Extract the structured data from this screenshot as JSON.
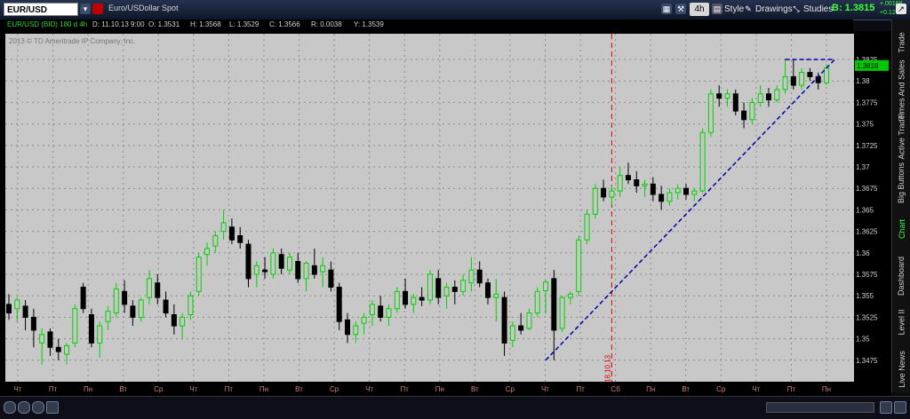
{
  "toolbar": {
    "symbol": "EUR/USD",
    "description": "Euro/USDollar Spot",
    "aggregation": "4h",
    "style_label": "Style",
    "drawings_label": "Drawings",
    "studies_label": "Studies",
    "bid_label": "B: 1.3815",
    "change_abs": "+.00168",
    "change_pct": "+0.12%"
  },
  "info": {
    "title": "EUR/USD (BID) 180 d 4h",
    "date": "D: 11.10.13 9:00",
    "open": "O: 1.3531",
    "high": "H: 1.3568",
    "low": "L: 1.3529",
    "close": "C: 1.3566",
    "range": "R: 0.0038",
    "y": "Y: 1.3539",
    "copyright": "2013 © TD Ameritrade IP Company, Inc."
  },
  "sidebar": {
    "tabs": [
      "Trade",
      "Times And Sales",
      "Active Trader",
      "Big Buttons",
      "Chart",
      "Dashboard",
      "Level II",
      "Live News"
    ],
    "active": "Chart"
  },
  "colors": {
    "bull": "#00d200",
    "bear": "#000000",
    "plot_bg": "#c8c8c8",
    "trendline": "#0000a8",
    "marker": "#e00000"
  },
  "chart_data": {
    "type": "candlestick",
    "ylim": [
      1.345,
      1.3855
    ],
    "y_ticks": [
      "1.3475",
      "1.35",
      "1.3525",
      "1.355",
      "1.3575",
      "1.36",
      "1.3625",
      "1.365",
      "1.3675",
      "1.37",
      "1.3725",
      "1.375",
      "1.3775",
      "1.38",
      "1.3825"
    ],
    "x_labels": [
      "Чт",
      "Пт",
      "Пн",
      "Вт",
      "Ср",
      "Чт",
      "Пт",
      "Пн",
      "Вт",
      "Ср",
      "Чт",
      "Пт",
      "Пн",
      "Вт",
      "Ср",
      "Чт",
      "Пт",
      "Сб",
      "Пн",
      "Вт",
      "Ср",
      "Чт",
      "Пт",
      "Пн"
    ],
    "last_price": "1.3818",
    "marker_label": "18.10.13",
    "grid": true,
    "candles": [
      [
        1.354,
        1.3552,
        1.3522,
        1.353
      ],
      [
        1.3535,
        1.3548,
        1.352,
        1.3545
      ],
      [
        1.3538,
        1.3545,
        1.351,
        1.3525
      ],
      [
        1.3525,
        1.3535,
        1.349,
        1.351
      ],
      [
        1.3495,
        1.3512,
        1.347,
        1.3505
      ],
      [
        1.3508,
        1.3512,
        1.348,
        1.349
      ],
      [
        1.349,
        1.35,
        1.3475,
        1.3485
      ],
      [
        1.3482,
        1.3495,
        1.347,
        1.3492
      ],
      [
        1.3495,
        1.354,
        1.349,
        1.3535
      ],
      [
        1.356,
        1.3565,
        1.353,
        1.3535
      ],
      [
        1.3528,
        1.3535,
        1.349,
        1.3495
      ],
      [
        1.3495,
        1.352,
        1.3478,
        1.3515
      ],
      [
        1.352,
        1.3538,
        1.351,
        1.3532
      ],
      [
        1.353,
        1.3565,
        1.3525,
        1.3558
      ],
      [
        1.3555,
        1.3568,
        1.353,
        1.354
      ],
      [
        1.3538,
        1.3545,
        1.3515,
        1.3525
      ],
      [
        1.3525,
        1.3548,
        1.352,
        1.3545
      ],
      [
        1.3548,
        1.358,
        1.354,
        1.357
      ],
      [
        1.3565,
        1.3575,
        1.354,
        1.3548
      ],
      [
        1.3545,
        1.3555,
        1.3525,
        1.353
      ],
      [
        1.3528,
        1.354,
        1.3505,
        1.3515
      ],
      [
        1.3515,
        1.353,
        1.35,
        1.3525
      ],
      [
        1.3528,
        1.3555,
        1.3522,
        1.355
      ],
      [
        1.3555,
        1.36,
        1.355,
        1.3595
      ],
      [
        1.3598,
        1.3612,
        1.3585,
        1.3605
      ],
      [
        1.3608,
        1.3625,
        1.36,
        1.362
      ],
      [
        1.3625,
        1.365,
        1.3615,
        1.3635
      ],
      [
        1.363,
        1.364,
        1.361,
        1.3615
      ],
      [
        1.362,
        1.363,
        1.3605,
        1.3612
      ],
      [
        1.361,
        1.3615,
        1.356,
        1.357
      ],
      [
        1.3575,
        1.359,
        1.356,
        1.3585
      ],
      [
        1.358,
        1.3595,
        1.357,
        1.3578
      ],
      [
        1.3575,
        1.3605,
        1.357,
        1.36
      ],
      [
        1.3598,
        1.3605,
        1.3575,
        1.3582
      ],
      [
        1.358,
        1.36,
        1.3575,
        1.3595
      ],
      [
        1.359,
        1.36,
        1.3565,
        1.357
      ],
      [
        1.357,
        1.359,
        1.3555,
        1.3588
      ],
      [
        1.3585,
        1.3605,
        1.357,
        1.3575
      ],
      [
        1.3578,
        1.3595,
        1.356,
        1.3585
      ],
      [
        1.358,
        1.359,
        1.3555,
        1.356
      ],
      [
        1.356,
        1.3565,
        1.351,
        1.352
      ],
      [
        1.3522,
        1.353,
        1.3495,
        1.3505
      ],
      [
        1.3505,
        1.352,
        1.3495,
        1.3515
      ],
      [
        1.3518,
        1.353,
        1.3505,
        1.3525
      ],
      [
        1.3528,
        1.3545,
        1.3515,
        1.354
      ],
      [
        1.3538,
        1.355,
        1.352,
        1.3525
      ],
      [
        1.3525,
        1.354,
        1.3515,
        1.3535
      ],
      [
        1.3535,
        1.356,
        1.353,
        1.3555
      ],
      [
        1.3555,
        1.357,
        1.3535,
        1.354
      ],
      [
        1.354,
        1.3552,
        1.353,
        1.3548
      ],
      [
        1.3548,
        1.356,
        1.3538,
        1.3545
      ],
      [
        1.3545,
        1.358,
        1.354,
        1.3575
      ],
      [
        1.357,
        1.358,
        1.354,
        1.3548
      ],
      [
        1.355,
        1.3565,
        1.3535,
        1.356
      ],
      [
        1.356,
        1.3568,
        1.354,
        1.3555
      ],
      [
        1.3555,
        1.3575,
        1.355,
        1.3568
      ],
      [
        1.3565,
        1.3595,
        1.3555,
        1.358
      ],
      [
        1.358,
        1.359,
        1.356,
        1.3565
      ],
      [
        1.3565,
        1.357,
        1.354,
        1.3548
      ],
      [
        1.3548,
        1.357,
        1.352,
        1.3552
      ],
      [
        1.3548,
        1.3555,
        1.348,
        1.3495
      ],
      [
        1.3498,
        1.352,
        1.349,
        1.3515
      ],
      [
        1.3515,
        1.353,
        1.3505,
        1.351
      ],
      [
        1.3512,
        1.3535,
        1.351,
        1.353
      ],
      [
        1.353,
        1.356,
        1.3525,
        1.3555
      ],
      [
        1.3556,
        1.3568,
        1.3529,
        1.3566
      ],
      [
        1.357,
        1.358,
        1.3475,
        1.351
      ],
      [
        1.3512,
        1.355,
        1.3508,
        1.3548
      ],
      [
        1.3548,
        1.3555,
        1.354,
        1.3552
      ],
      [
        1.3555,
        1.362,
        1.355,
        1.3615
      ],
      [
        1.3615,
        1.365,
        1.361,
        1.3645
      ],
      [
        1.3645,
        1.368,
        1.364,
        1.3675
      ],
      [
        1.3675,
        1.3685,
        1.366,
        1.3665
      ],
      [
        1.3665,
        1.3678,
        1.3655,
        1.3672
      ],
      [
        1.3672,
        1.37,
        1.3665,
        1.369
      ],
      [
        1.369,
        1.3705,
        1.368,
        1.3685
      ],
      [
        1.3685,
        1.3695,
        1.367,
        1.3678
      ],
      [
        1.3678,
        1.3685,
        1.3665,
        1.368
      ],
      [
        1.368,
        1.3688,
        1.366,
        1.3668
      ],
      [
        1.3668,
        1.3678,
        1.365,
        1.366
      ],
      [
        1.366,
        1.3675,
        1.3655,
        1.367
      ],
      [
        1.367,
        1.368,
        1.3662,
        1.3675
      ],
      [
        1.3675,
        1.368,
        1.3662,
        1.3668
      ],
      [
        1.3668,
        1.3675,
        1.366,
        1.3672
      ],
      [
        1.3672,
        1.3745,
        1.367,
        1.374
      ],
      [
        1.374,
        1.379,
        1.3735,
        1.3785
      ],
      [
        1.3785,
        1.3795,
        1.377,
        1.378
      ],
      [
        1.378,
        1.379,
        1.377,
        1.3785
      ],
      [
        1.3785,
        1.379,
        1.376,
        1.3765
      ],
      [
        1.3765,
        1.3775,
        1.3745,
        1.3755
      ],
      [
        1.3755,
        1.378,
        1.375,
        1.3775
      ],
      [
        1.3775,
        1.3795,
        1.377,
        1.3785
      ],
      [
        1.3785,
        1.3792,
        1.377,
        1.3778
      ],
      [
        1.3778,
        1.3795,
        1.3775,
        1.379
      ],
      [
        1.379,
        1.3825,
        1.3785,
        1.3805
      ],
      [
        1.3805,
        1.3825,
        1.379,
        1.3795
      ],
      [
        1.3795,
        1.3815,
        1.379,
        1.381
      ],
      [
        1.381,
        1.3815,
        1.38,
        1.3805
      ],
      [
        1.3805,
        1.381,
        1.379,
        1.3798
      ],
      [
        1.3798,
        1.382,
        1.3795,
        1.3815
      ]
    ],
    "marker_index": 73,
    "trendline": {
      "from_index": 65,
      "from_price": 1.3475,
      "to_index": 100,
      "to_price": 1.3825
    },
    "top_line": {
      "from_index": 94,
      "to_index": 100,
      "price": 1.3825
    }
  }
}
